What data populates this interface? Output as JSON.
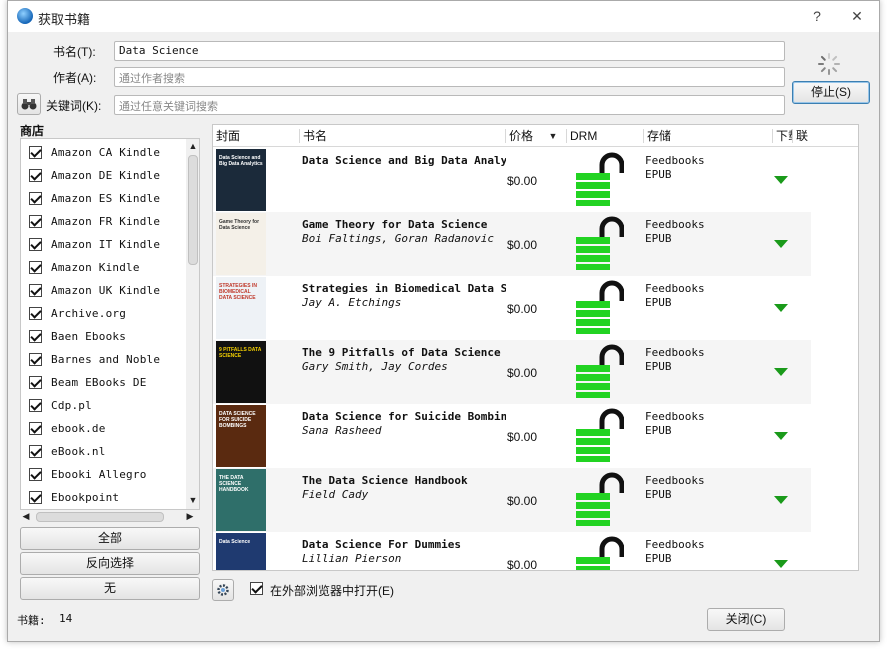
{
  "window": {
    "title": "获取书籍",
    "help": "?",
    "close": "✕"
  },
  "search": {
    "title_label": "书名(T):",
    "title_value": "Data Science",
    "author_label": "作者(A):",
    "author_placeholder": "通过作者搜索",
    "keyword_label": "关键词(K):",
    "keyword_placeholder": "通过任意关键词搜索",
    "stop_button": "停止(S)"
  },
  "stores": {
    "heading": "商店",
    "items": [
      "Amazon CA Kindle",
      "Amazon DE Kindle",
      "Amazon ES Kindle",
      "Amazon FR Kindle",
      "Amazon IT Kindle",
      "Amazon Kindle",
      "Amazon UK Kindle",
      "Archive.org",
      "Baen Ebooks",
      "Barnes and Noble",
      "Beam EBooks DE",
      "Cdp.pl",
      "ebook.de",
      "eBook.nl",
      "Ebooki Allegro",
      "Ebookpoint"
    ],
    "select_all": "全部",
    "invert": "反向选择",
    "none": "无"
  },
  "table": {
    "headers": {
      "cover": "封面",
      "title": "书名",
      "price": "价格",
      "drm": "DRM",
      "storage": "存储",
      "download": "下载",
      "affiliate": "联"
    },
    "rows": [
      {
        "title": "Data Science and Big Data Analytics",
        "author": "",
        "price": "$0.00",
        "store": "Feedbooks",
        "format": "EPUB",
        "cover_text": "Data Science and Big Data Analytics",
        "cover_bg": "#1b2a3a",
        "cover_fg": "#ffffff"
      },
      {
        "title": "Game Theory for Data Science",
        "author": "Boi Faltings, Goran Radanovic",
        "price": "$0.00",
        "store": "Feedbooks",
        "format": "EPUB",
        "cover_text": "Game Theory for Data Science",
        "cover_bg": "#f4f0e8",
        "cover_fg": "#333333"
      },
      {
        "title": "Strategies in Biomedical Data Science",
        "author": "Jay A. Etchings",
        "price": "$0.00",
        "store": "Feedbooks",
        "format": "EPUB",
        "cover_text": "STRATEGIES IN BIOMEDICAL DATA SCIENCE",
        "cover_bg": "#eef2f6",
        "cover_fg": "#c0392b"
      },
      {
        "title": "The 9 Pitfalls of Data Science",
        "author": "Gary Smith, Jay Cordes",
        "price": "$0.00",
        "store": "Feedbooks",
        "format": "EPUB",
        "cover_text": "9 PITFALLS DATA SCIENCE",
        "cover_bg": "#111111",
        "cover_fg": "#f4d000"
      },
      {
        "title": "Data Science for Suicide Bombings",
        "author": "Sana Rasheed",
        "price": "$0.00",
        "store": "Feedbooks",
        "format": "EPUB",
        "cover_text": "DATA SCIENCE FOR SUICIDE BOMBINGS",
        "cover_bg": "#5a2a10",
        "cover_fg": "#ffffff"
      },
      {
        "title": "The Data Science Handbook",
        "author": "Field Cady",
        "price": "$0.00",
        "store": "Feedbooks",
        "format": "EPUB",
        "cover_text": "THE DATA SCIENCE HANDBOOK",
        "cover_bg": "#2f6f6a",
        "cover_fg": "#ffffff"
      },
      {
        "title": "Data Science For Dummies",
        "author": "Lillian Pierson",
        "price": "$0.00",
        "store": "Feedbooks",
        "format": "EPUB",
        "cover_text": "Data Science",
        "cover_bg": "#1f3a70",
        "cover_fg": "#ffffff"
      }
    ]
  },
  "footer": {
    "open_external": "在外部浏览器中打开(E)",
    "books_label": "书籍:",
    "books_count": "14",
    "close_button": "关闭(C)"
  },
  "colors": {
    "drm_green": "#22d322",
    "download_green": "#1a9a1a",
    "stop_border": "#3c7fb1"
  },
  "icons": {
    "window": "globe-icon",
    "keyword": "binoculars-icon",
    "config": "gear-icon",
    "drm": "unlocked-padlock-icon",
    "download": "download-arrow-icon",
    "loading": "spinner-icon"
  }
}
